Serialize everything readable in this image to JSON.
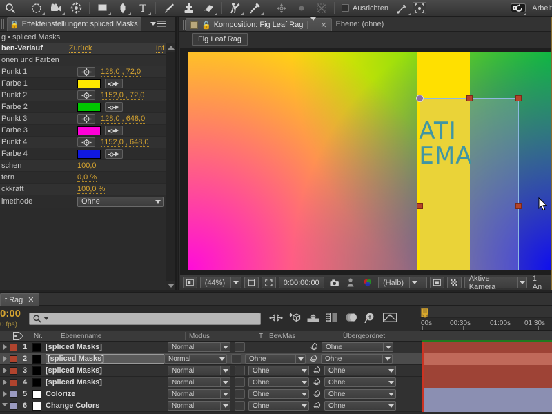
{
  "toolbar": {
    "tools": [
      {
        "name": "zoom-tool",
        "icon": "magnifier"
      },
      {
        "name": "orbit-camera-tool",
        "icon": "orbit"
      },
      {
        "name": "camera-tool",
        "icon": "camera"
      },
      {
        "name": "pan-behind-tool",
        "icon": "pan-behind"
      },
      {
        "name": "shape-tool",
        "icon": "rectangle"
      },
      {
        "name": "pen-tool",
        "icon": "pen"
      },
      {
        "name": "type-tool",
        "icon": "text-T"
      },
      {
        "name": "brush-tool",
        "icon": "brush"
      },
      {
        "name": "clone-stamp-tool",
        "icon": "stamp"
      },
      {
        "name": "eraser-tool",
        "icon": "eraser"
      },
      {
        "name": "roto-brush-tool",
        "icon": "roto-brush"
      },
      {
        "name": "puppet-pin-tool",
        "icon": "pushpin"
      }
    ],
    "align_label": "Ausrichten",
    "workspace_label": "Arbeit"
  },
  "effect_controls": {
    "tab_title": "Effekteinstellungen: spliced Masks",
    "breadcrumb": "g • spliced Masks",
    "effect_name": "ben-Verlauf",
    "reset_label": "Zurück",
    "about_label": "Inf",
    "group_label": "onen und Farben",
    "params": [
      {
        "label": "Punkt 1",
        "type": "point",
        "value": "128,0 , 72,0"
      },
      {
        "label": "Farbe 1",
        "type": "color",
        "color": "#ffe800"
      },
      {
        "label": "Punkt 2",
        "type": "point",
        "value": "1152,0 , 72,0"
      },
      {
        "label": "Farbe 2",
        "type": "color",
        "color": "#00c800"
      },
      {
        "label": "Punkt 3",
        "type": "point",
        "value": "128,0 , 648,0"
      },
      {
        "label": "Farbe 3",
        "type": "color",
        "color": "#ff00d8"
      },
      {
        "label": "Punkt 4",
        "type": "point",
        "value": "1152,0 , 648,0"
      },
      {
        "label": "Farbe 4",
        "type": "color",
        "color": "#1018e0"
      },
      {
        "label": "schen",
        "type": "value",
        "value": "100,0"
      },
      {
        "label": "tern",
        "type": "value",
        "value": "0,0 %"
      },
      {
        "label": "ckkraft",
        "type": "value",
        "value": "100,0 %"
      },
      {
        "label": "lmethode",
        "type": "dropdown",
        "value": "Ohne"
      }
    ]
  },
  "composition": {
    "tab_active": "Komposition: Fig Leaf Rag",
    "tab_inactive": "Ebene: (ohne)",
    "breadcrumb": "Fig Leaf Rag",
    "canvas_text_line1": "ATI",
    "canvas_text_line2": "EMA",
    "bottom_bar": {
      "zoom": "(44%)",
      "timecode": "0:00:00:00",
      "quality": "(Halb)",
      "camera": "Aktive Kamera",
      "views": "1 An"
    }
  },
  "timeline": {
    "tab_label": "f Rag",
    "current_time": "0:00",
    "fps_label": "0 fps)",
    "search_placeholder": "",
    "columns": {
      "num": "Nr.",
      "layer_name": "Ebenenname",
      "mode": "Modus",
      "t": "T",
      "track_matte": "BewMas",
      "parent": "Übergeordnet"
    },
    "ruler_ticks": [
      "00s",
      "00:30s",
      "01:00s",
      "01:30s"
    ],
    "layers": [
      {
        "num": "1",
        "name": "[spliced Masks]",
        "mode": "Normal",
        "matte": "",
        "parent": "Ohne",
        "color": "#b0442e",
        "swatch": "#000000",
        "editing": false,
        "selected": false,
        "bar": "#9e4336",
        "twirl": "closed"
      },
      {
        "num": "2",
        "name": "[spliced Masks]",
        "mode": "Normal",
        "matte": "Ohne",
        "parent": "Ohne",
        "color": "#b0442e",
        "swatch": "#000000",
        "editing": true,
        "selected": true,
        "bar": "#c0695a",
        "twirl": "closed"
      },
      {
        "num": "3",
        "name": "[spliced Masks]",
        "mode": "Normal",
        "matte": "Ohne",
        "parent": "Ohne",
        "color": "#b0442e",
        "swatch": "#000000",
        "editing": false,
        "selected": false,
        "bar": "#9e4336",
        "twirl": "closed"
      },
      {
        "num": "4",
        "name": "[spliced Masks]",
        "mode": "Normal",
        "matte": "Ohne",
        "parent": "Ohne",
        "color": "#b0442e",
        "swatch": "#000000",
        "editing": false,
        "selected": false,
        "bar": "#9e4336",
        "twirl": "closed"
      },
      {
        "num": "5",
        "name": "Colorize",
        "mode": "Normal",
        "matte": "Ohne",
        "parent": "Ohne",
        "color": "#9a9ac0",
        "swatch": "#ffffff",
        "editing": false,
        "selected": false,
        "bar": "#8b8fb2",
        "twirl": "closed"
      },
      {
        "num": "6",
        "name": "Change Colors",
        "mode": "Normal",
        "matte": "Ohne",
        "parent": "Ohne",
        "color": "#9a9ac0",
        "swatch": "#ffffff",
        "editing": false,
        "selected": false,
        "bar": "#8b8fb2",
        "twirl": "open"
      }
    ]
  }
}
